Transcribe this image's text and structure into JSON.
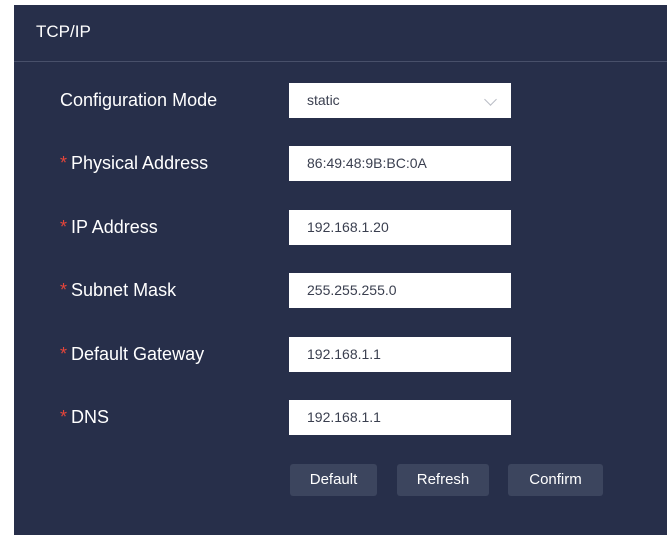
{
  "panel": {
    "title": "TCP/IP"
  },
  "form": {
    "config_mode": {
      "label": "Configuration Mode",
      "value": "static"
    },
    "physical_address": {
      "required_mark": "*",
      "label": "Physical Address",
      "value": "86:49:48:9B:BC:0A"
    },
    "ip_address": {
      "required_mark": "*",
      "label": "IP Address",
      "value": "192.168.1.20"
    },
    "subnet_mask": {
      "required_mark": "*",
      "label": "Subnet Mask",
      "value": "255.255.255.0"
    },
    "default_gateway": {
      "required_mark": "*",
      "label": "Default Gateway",
      "value": "192.168.1.1"
    },
    "dns": {
      "required_mark": "*",
      "label": "DNS",
      "value": "192.168.1.1"
    }
  },
  "buttons": {
    "default_label": "Default",
    "refresh_label": "Refresh",
    "confirm_label": "Confirm"
  },
  "colors": {
    "panel_bg": "#272f4a",
    "required_star": "#e4453a",
    "button_bg": "#3c455e"
  },
  "icons": {
    "select_arrow": "chevron-down-icon"
  }
}
